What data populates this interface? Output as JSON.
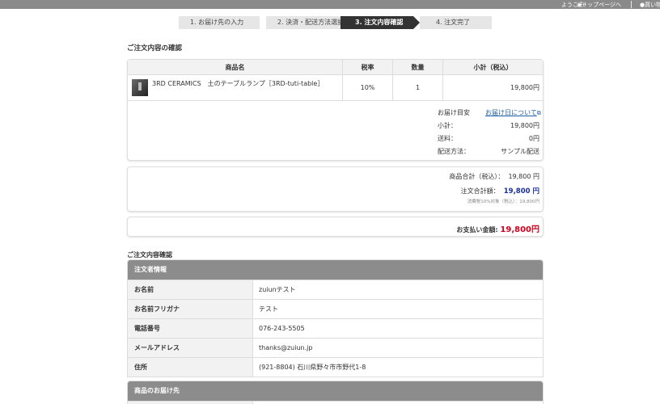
{
  "topbar": {
    "welcome": "ようこそ！",
    "top_link": "◉トップページへ",
    "cart_link": "●買い物"
  },
  "steps": [
    {
      "label": "1. お届け先の入力"
    },
    {
      "label": "2. 決済・配送方法選択"
    },
    {
      "label": "3. 注文内容確認"
    },
    {
      "label": "4. 注文完了"
    }
  ],
  "order_section_title": "ご注文内容の確認",
  "order_table": {
    "headers": {
      "name": "商品名",
      "tax": "税率",
      "qty": "数量",
      "subtotal": "小計（税込）"
    },
    "row": {
      "name": "3RD CERAMICS　土のテーブルランプ［3RD-tuti-table］",
      "tax": "10%",
      "qty": "1",
      "subtotal": "19,800円"
    }
  },
  "delivery_summary": {
    "eta_label": "お届け目安",
    "eta_link": "お届け日について",
    "subtotal_label": "小計：",
    "subtotal_value": "19,800円",
    "shipping_label": "送料：",
    "shipping_value": "0円",
    "method_label": "配送方法：",
    "method_value": "サンプル配送"
  },
  "totals": {
    "goods_label": "商品合計（税込）：",
    "goods_value": "19,800 円",
    "order_label": "注文合計額：",
    "order_value": "19,800 円",
    "tax_note": "消費税10%対象（税込）：19,800円"
  },
  "payment": {
    "label": "お支払い金額:",
    "value": "19,800円"
  },
  "confirm_section_title": "ご注文内容確認",
  "orderer": {
    "title": "注文者情報",
    "rows": [
      {
        "label": "お名前",
        "value": "zuiunテスト"
      },
      {
        "label": "お名前フリガナ",
        "value": "テスト"
      },
      {
        "label": "電話番号",
        "value": "076-243-5505"
      },
      {
        "label": "メールアドレス",
        "value": "thanks@zuiun.jp"
      },
      {
        "label": "住所",
        "value": "(921-8804) 石川県野々市市野代1-8"
      }
    ]
  },
  "delivery_dest": {
    "title": "商品のお届け先"
  },
  "colors": {
    "step_active": "#333333",
    "payment_red": "#d0021b",
    "order_total_blue": "#1a2fa0",
    "link_blue": "#1f5fa8"
  }
}
